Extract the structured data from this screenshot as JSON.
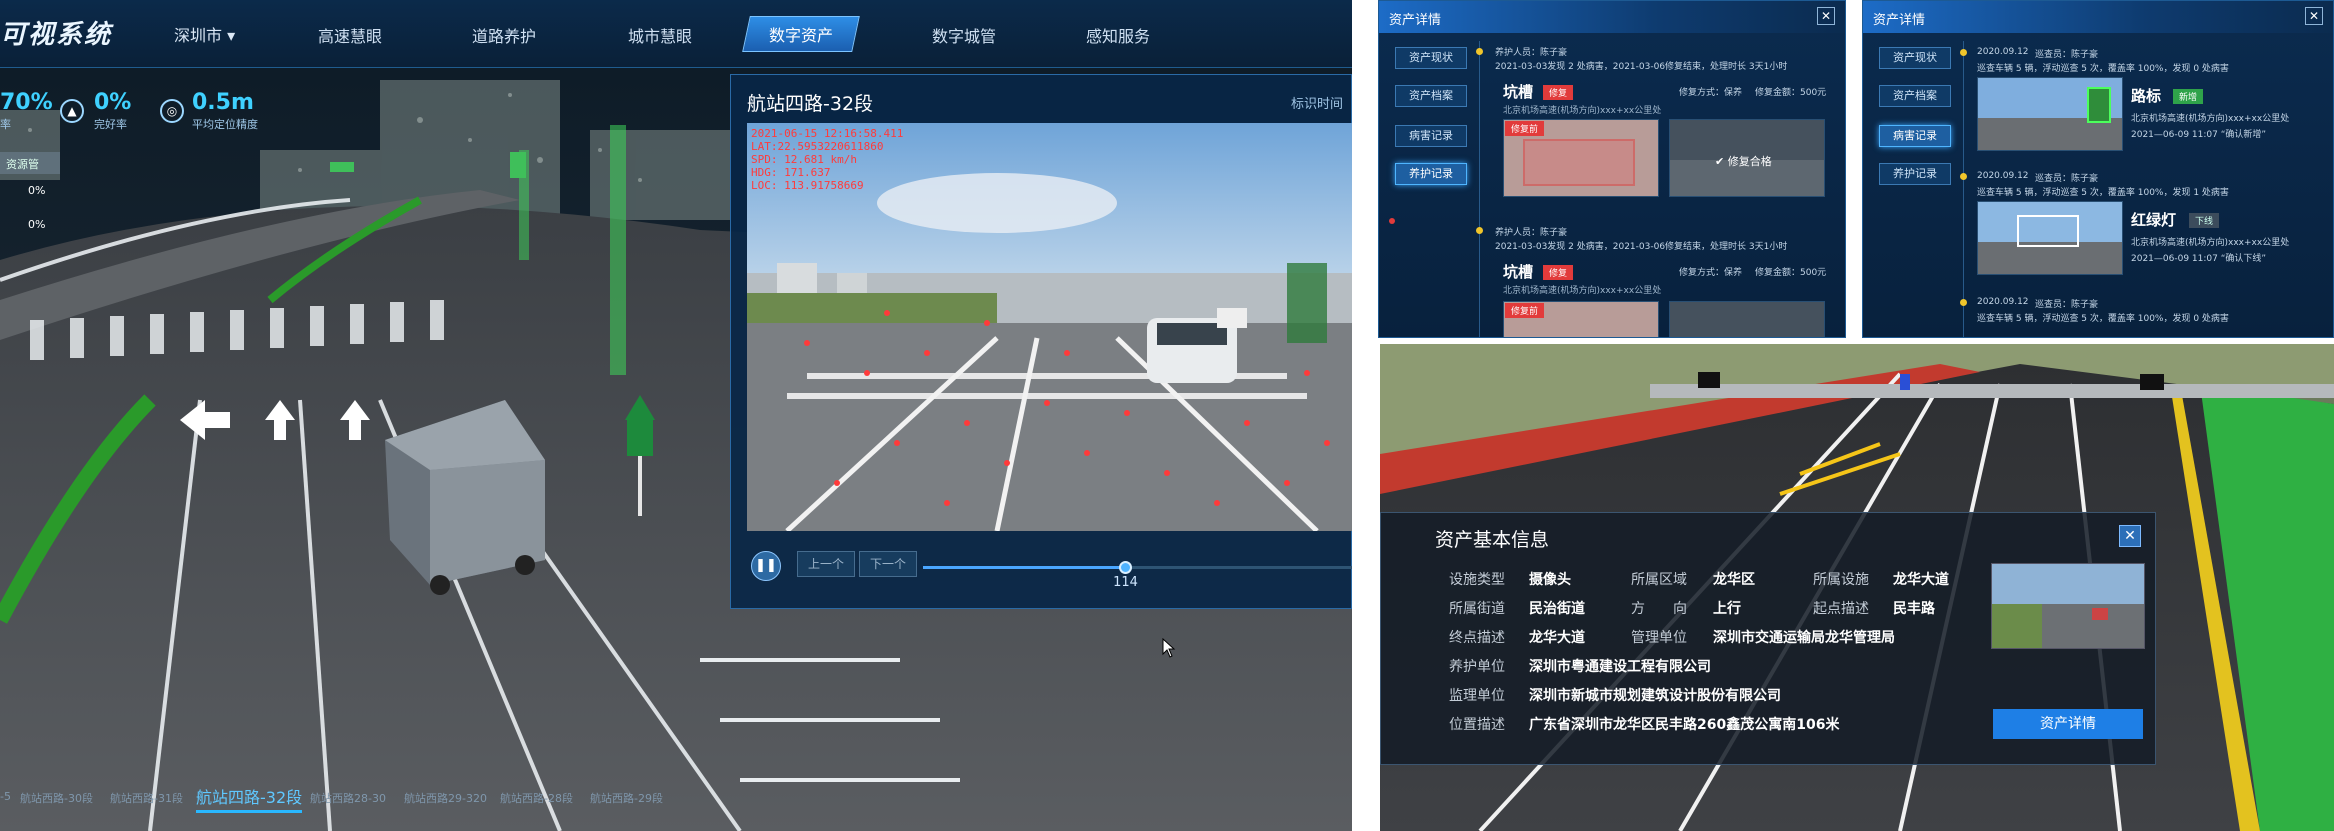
{
  "left": {
    "app_title": "可视系统",
    "city": "深圳市",
    "nav": [
      "高速慧眼",
      "道路养护",
      "城市慧眼",
      "数字资产",
      "数字城管",
      "感知服务"
    ],
    "nav_active": "数字资产",
    "stats": [
      {
        "value": "70%",
        "label": "率"
      },
      {
        "value": "0%",
        "label": "完好率"
      },
      {
        "value": "0.5m",
        "label": "平均定位精度"
      }
    ],
    "side_box": "资源管",
    "side_pcts": [
      "0%",
      "0%"
    ],
    "video": {
      "title": "航站四路-32段",
      "right_label": "标识时间",
      "overlay": [
        "2021-06-15 12:16:58.411",
        "LAT:22.5953220611860",
        "SPD: 12.681 km/h",
        "HDG: 171.637",
        "LOC: 113.91758669"
      ],
      "prev": "上一个",
      "next": "下一个",
      "frame": "114",
      "progress": 0.47
    },
    "timeline": [
      "-5",
      "航站西路-30段",
      "航站西路-31段",
      "航站四路-32段",
      "航站西路28-30",
      "航站西路29-320",
      "航站西路-28段",
      "航站西路-29段"
    ],
    "timeline_active": "航站四路-32段"
  },
  "panel1": {
    "title": "资产详情",
    "tabs": [
      "资产现状",
      "资产档案",
      "病害记录",
      "养护记录"
    ],
    "selected": "养护记录",
    "records": [
      {
        "person": "养护人员：陈子豪",
        "line": "2021-03-03发现 2 处病害，2021-03-06修复结束，处理时长 3天1小时",
        "type": "坑槽",
        "tag": "修复",
        "method": "修复方式：保养",
        "cost": "修复金额：500元",
        "img_tag": "修复前",
        "result": "修复合格",
        "addr": "北京机场高速(机场方向)xxx+xx公里处"
      },
      {
        "person": "养护人员：陈子豪",
        "line": "2021-03-03发现 2 处病害，2021-03-06修复结束，处理时长 3天1小时",
        "type": "坑槽",
        "tag": "修复",
        "method": "修复方式：保养",
        "cost": "修复金额：500元",
        "img_tag": "修复前",
        "result": "",
        "addr": "北京机场高速(机场方向)xxx+xx公里处"
      }
    ]
  },
  "panel2": {
    "title": "资产详情",
    "tabs": [
      "资产现状",
      "资产档案",
      "病害记录",
      "养护记录"
    ],
    "selected": "病害记录",
    "records": [
      {
        "date": "2020.09.12",
        "person": "巡查员：陈子豪",
        "line": "巡查车辆 5 辆，浮动巡查 5 次，覆盖率 100%，发现 0 处病害",
        "name": "路标",
        "tag": "新增",
        "addr": "北京机场高速(机场方向)xxx+xx公里处",
        "time": "2021—06-09 11:07 “确认新增”"
      },
      {
        "date": "2020.09.12",
        "person": "巡查员：陈子豪",
        "line": "巡查车辆 5 辆，浮动巡查 5 次，覆盖率 100%，发现 1 处病害",
        "name": "红绿灯",
        "tag": "下线",
        "addr": "北京机场高速(机场方向)xxx+xx公里处",
        "time": "2021—06-09 11:07 “确认下线”"
      },
      {
        "date": "2020.09.12",
        "person": "巡查员：陈子豪",
        "line": "巡查车辆 5 辆，浮动巡查 5 次，覆盖率 100%，发现 0 处病害",
        "name": "",
        "tag": "",
        "addr": "",
        "time": ""
      }
    ]
  },
  "info": {
    "title": "资产基本信息",
    "rows": [
      [
        {
          "k": "设施类型",
          "v": "摄像头"
        },
        {
          "k": "所属区域",
          "v": "龙华区"
        },
        {
          "k": "所属设施",
          "v": "龙华大道"
        }
      ],
      [
        {
          "k": "所属街道",
          "v": "民治街道"
        },
        {
          "k": "方　　向",
          "v": "上行"
        },
        {
          "k": "起点描述",
          "v": "民丰路"
        }
      ],
      [
        {
          "k": "终点描述",
          "v": "龙华大道"
        },
        {
          "k": "管理单位",
          "v": "深圳市交通运输局龙华管理局"
        }
      ],
      [
        {
          "k": "养护单位",
          "v": "深圳市粤通建设工程有限公司"
        }
      ],
      [
        {
          "k": "监理单位",
          "v": "深圳市新城市规划建筑设计股份有限公司"
        }
      ],
      [
        {
          "k": "位置描述",
          "v": "广东省深圳市龙华区民丰路260鑫茂公寓南106米"
        }
      ]
    ],
    "button": "资产详情"
  },
  "colors": {
    "accent": "#1e7fe6",
    "active_tab": "#2e8ee6",
    "alert": "#e23b3b",
    "new_tag": "#2fa34a"
  }
}
